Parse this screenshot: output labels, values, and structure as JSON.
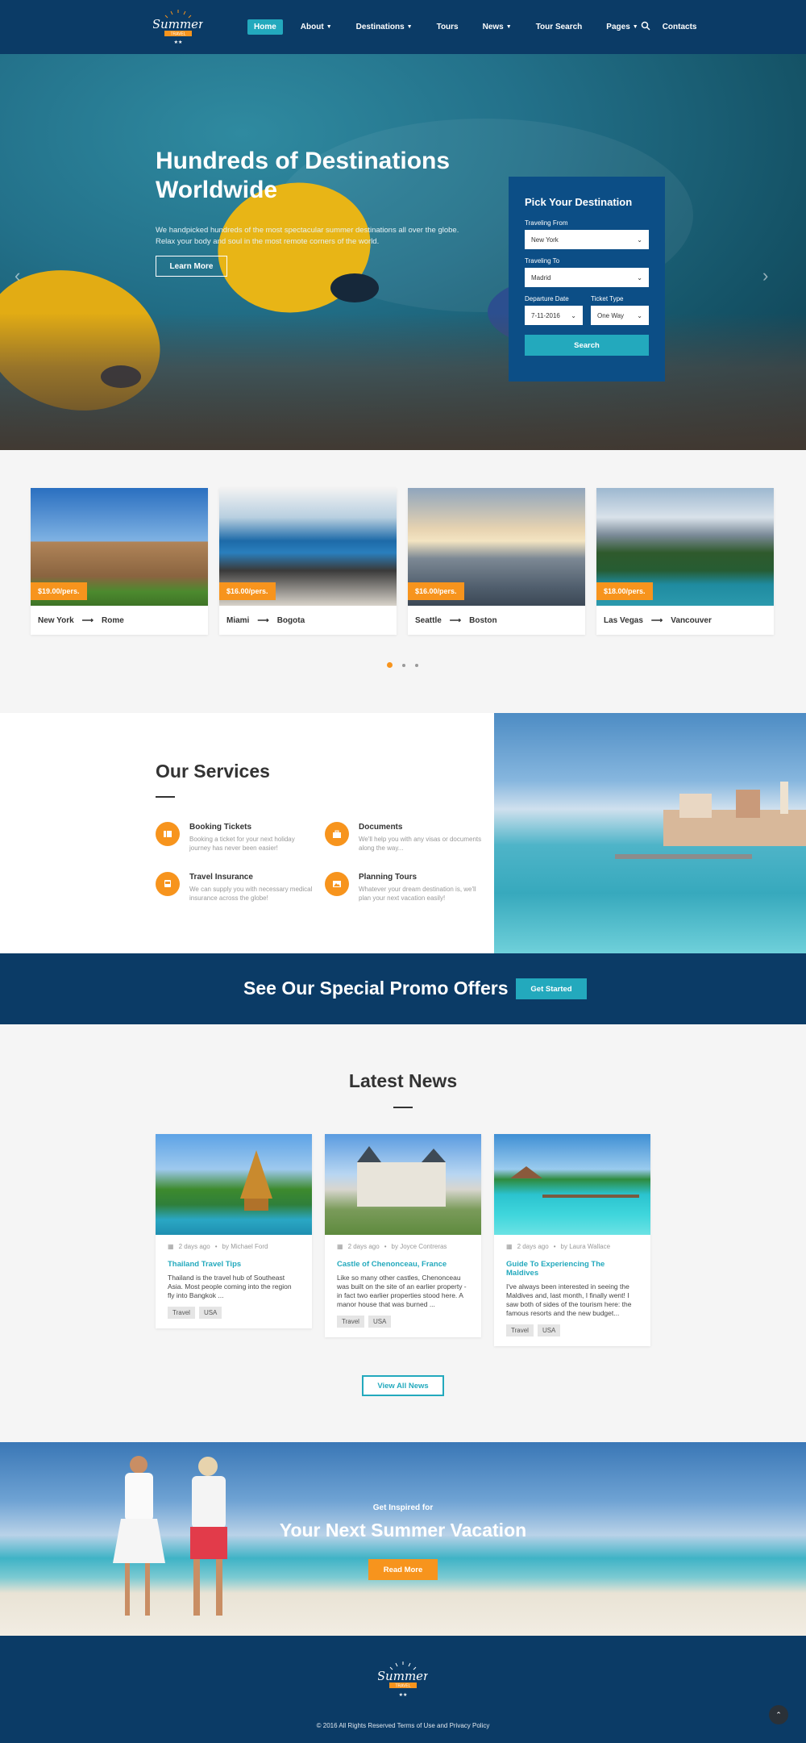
{
  "brand": {
    "logo_text": "Summer",
    "logo_banner": "TRAVEL"
  },
  "nav": {
    "items": [
      {
        "label": "Home",
        "active": true,
        "dropdown": false
      },
      {
        "label": "About",
        "active": false,
        "dropdown": true
      },
      {
        "label": "Destinations",
        "active": false,
        "dropdown": true
      },
      {
        "label": "Tours",
        "active": false,
        "dropdown": false
      },
      {
        "label": "News",
        "active": false,
        "dropdown": true
      },
      {
        "label": "Tour Search",
        "active": false,
        "dropdown": false
      },
      {
        "label": "Pages",
        "active": false,
        "dropdown": true
      },
      {
        "label": "Contacts",
        "active": false,
        "dropdown": false
      }
    ],
    "search_icon": "search-icon"
  },
  "hero": {
    "title": "Hundreds of Destinations Worldwide",
    "text": "We handpicked hundreds of the most spectacular summer destinations all over the globe. Relax your body and soul in the most remote corners of the world.",
    "button": "Learn More"
  },
  "booking": {
    "title": "Pick Your Destination",
    "from_label": "Traveling From",
    "from_value": "New York",
    "to_label": "Traveling To",
    "to_value": "Madrid",
    "date_label": "Departure Date",
    "date_value": "7-11-2016",
    "type_label": "Ticket Type",
    "type_value": "One Way",
    "button": "Search"
  },
  "destinations": [
    {
      "price": "$19.00/pers.",
      "from": "New York",
      "to": "Rome"
    },
    {
      "price": "$16.00/pers.",
      "from": "Miami",
      "to": "Bogota"
    },
    {
      "price": "$16.00/pers.",
      "from": "Seattle",
      "to": "Boston"
    },
    {
      "price": "$18.00/pers.",
      "from": "Las Vegas",
      "to": "Vancouver"
    }
  ],
  "services": {
    "title": "Our Services",
    "items": [
      {
        "title": "Booking Tickets",
        "text": "Booking a ticket for your next holiday journey has never been easier!",
        "icon": "ticket-icon"
      },
      {
        "title": "Documents",
        "text": "We'll help you with any visas or documents along the way...",
        "icon": "briefcase-icon"
      },
      {
        "title": "Travel Insurance",
        "text": "We can supply you with necessary medical insurance across the globe!",
        "icon": "bus-icon"
      },
      {
        "title": "Planning Tours",
        "text": "Whatever your dream destination is, we'll plan your next vacation easily!",
        "icon": "picture-icon"
      }
    ]
  },
  "promo": {
    "text": "See Our Special Promo Offers",
    "button": "Get Started"
  },
  "news": {
    "title": "Latest News",
    "items": [
      {
        "date": "2 days ago",
        "author": "by Michael Ford",
        "title": "Thailand Travel Tips",
        "text": "Thailand is the travel hub of Southeast Asia. Most people coming into the region fly into Bangkok ...",
        "tags": [
          "Travel",
          "USA"
        ]
      },
      {
        "date": "2 days ago",
        "author": "by Joyce Contreras",
        "title": "Castle of Chenonceau, France",
        "text": "Like so many other castles, Chenonceau was built on the site of an earlier property - in fact two earlier properties stood here. A manor house that was burned ...",
        "tags": [
          "Travel",
          "USA"
        ]
      },
      {
        "date": "2 days ago",
        "author": "by Laura Wallace",
        "title": "Guide To Experiencing The Maldives",
        "text": "I've always been interested in seeing the Maldives and, last month, I finally went! I saw both of sides of the tourism here: the famous resorts and the new budget...",
        "tags": [
          "Travel",
          "USA"
        ]
      }
    ],
    "button": "View All News"
  },
  "inspire": {
    "sub": "Get Inspired for",
    "title": "Your Next Summer Vacation",
    "button": "Read More"
  },
  "footer": {
    "copyright": "© 2016 All Rights Reserved Terms of Use and Privacy Policy",
    "to_top_icon": "chevron-up-icon"
  },
  "colors": {
    "navy": "#0b3b66",
    "teal": "#23a9bd",
    "orange": "#f7941d",
    "booking_blue": "#0c4e86"
  }
}
